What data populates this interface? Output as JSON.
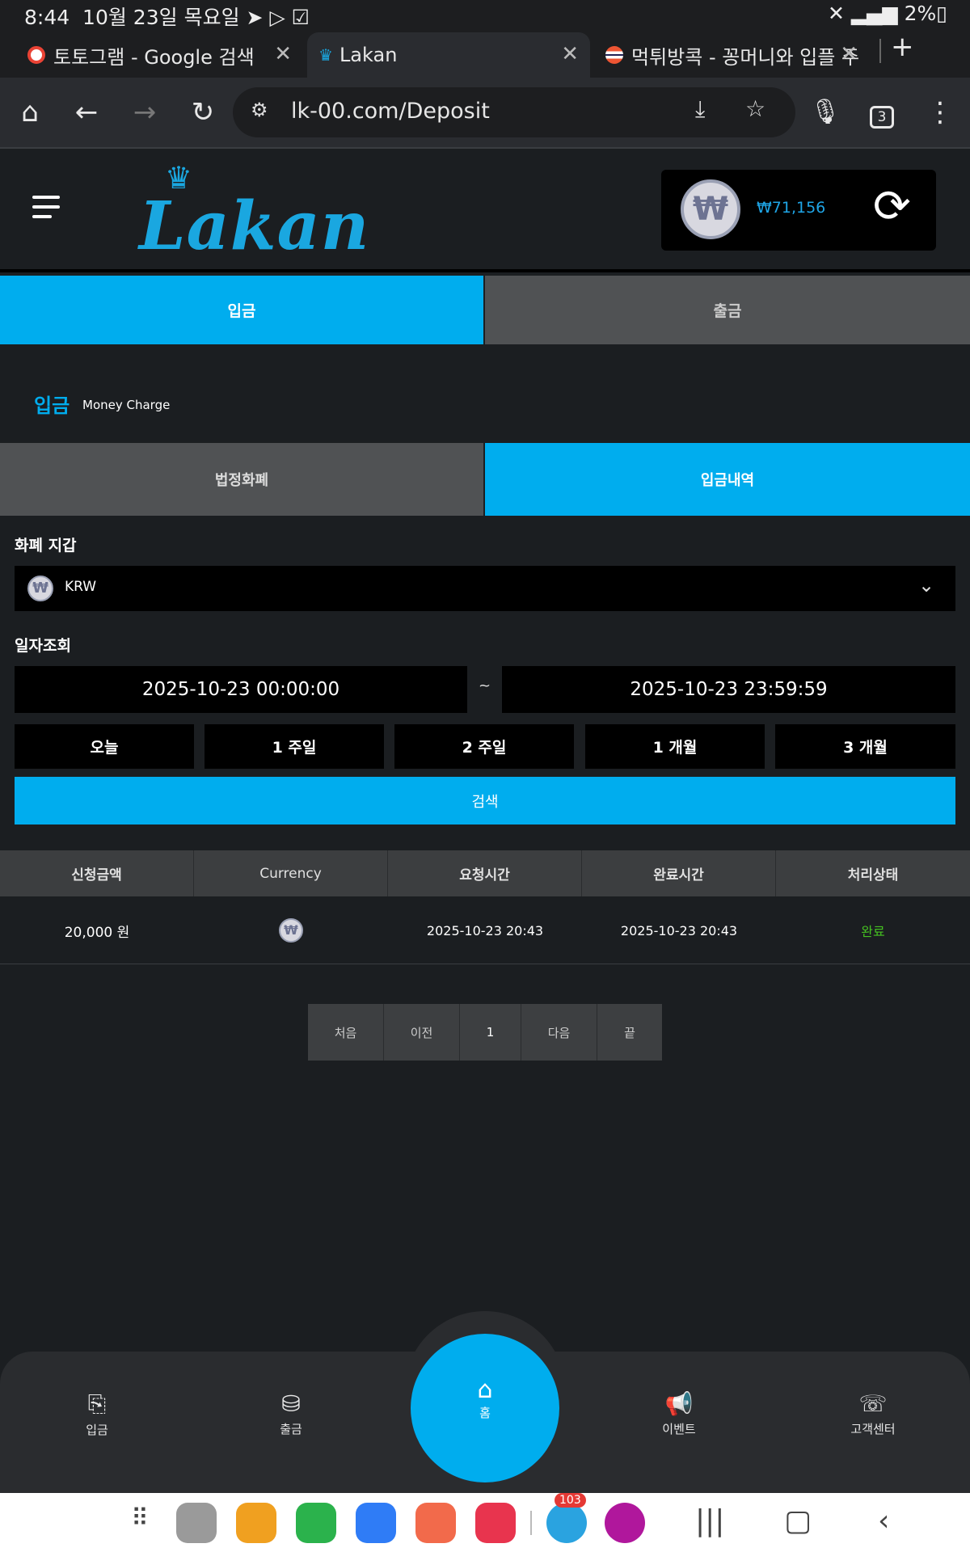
{
  "status_bar": {
    "time": "8:44",
    "date": "10월 23일 목요일",
    "battery": "2%"
  },
  "browser": {
    "tabs": [
      {
        "title": "토토그램 - Google 검색",
        "active": false
      },
      {
        "title": "Lakan",
        "active": true
      },
      {
        "title": "먹튀방콕 - 꽁머니와 입플 주",
        "active": false
      }
    ],
    "url": "lk-00.com/Deposit",
    "tab_count": "3"
  },
  "site": {
    "logo": "Lakan",
    "balance": "₩71,156",
    "currency_symbol": "₩"
  },
  "top_tabs": [
    {
      "label": "입금",
      "active": true
    },
    {
      "label": "출금",
      "active": false
    }
  ],
  "section": {
    "title": "입금",
    "subtitle": "Money Charge"
  },
  "sub_tabs": [
    {
      "label": "법정화폐",
      "active": false
    },
    {
      "label": "입금내역",
      "active": true
    }
  ],
  "wallet_select": {
    "label": "화폐 지갑",
    "value": "KRW"
  },
  "date_query": {
    "label": "일자조회",
    "start": "2025-10-23 00:00:00",
    "separator": "~",
    "end": "2025-10-23 23:59:59"
  },
  "period_buttons": [
    "오늘",
    "1 주일",
    "2 주일",
    "1 개월",
    "3 개월"
  ],
  "search_button": "검색",
  "table": {
    "headers": [
      "신청금액",
      "Currency",
      "요청시간",
      "완료시간",
      "처리상태"
    ],
    "rows": [
      {
        "amount": "20,000 원",
        "currency_icon": "won-coin-icon",
        "requested": "2025-10-23 20:43",
        "completed": "2025-10-23 20:43",
        "status": "완료"
      }
    ]
  },
  "pagination": [
    "처음",
    "이전",
    "1",
    "다음",
    "끝"
  ],
  "bottom_nav": [
    {
      "label": "입금",
      "icon": "deposit-icon"
    },
    {
      "label": "출금",
      "icon": "withdraw-icon"
    },
    {
      "label": "홈",
      "icon": "home-icon"
    },
    {
      "label": "이벤트",
      "icon": "megaphone-icon"
    },
    {
      "label": "고객센터",
      "icon": "support-24-icon"
    }
  ],
  "colors": {
    "accent": "#00adee",
    "bg": "#1b1e21",
    "status_done": "#44c021"
  },
  "android_badge": "103"
}
